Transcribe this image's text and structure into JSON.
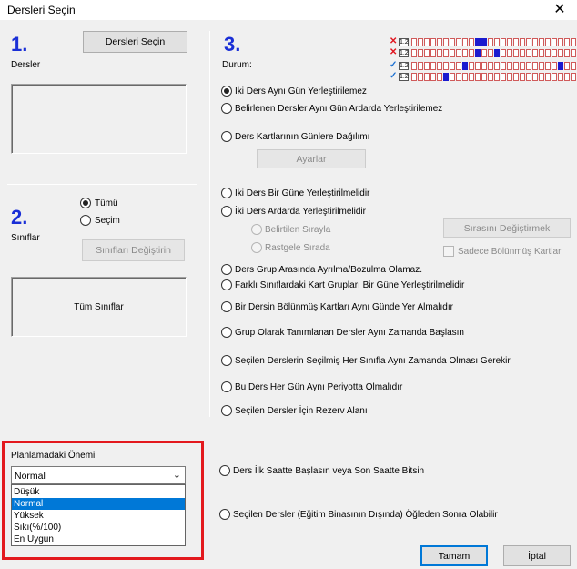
{
  "window": {
    "title": "Dersleri Seçin",
    "close_glyph": "✕"
  },
  "step1": {
    "number": "1.",
    "label": "Dersler",
    "select_button": "Dersleri Seçin"
  },
  "step2": {
    "number": "2.",
    "label": "Sınıflar",
    "radio_all": "Tümü",
    "radio_selection": "Seçim",
    "change_button": "Sınıfları Değiştirin",
    "classes_box": "Tüm Sınıflar"
  },
  "importance": {
    "label": "Planlamadaki Önemi",
    "selected": "Normal",
    "options": [
      "Düşük",
      "Normal",
      "Yüksek",
      "Sıkı(%/100)",
      "En Uygun"
    ]
  },
  "step3": {
    "number": "3.",
    "status_label": "Durum:",
    "status_rows": [
      {
        "mark": "✕",
        "code": "1.2"
      },
      {
        "mark": "✕",
        "code": "1.2"
      },
      {
        "mark": "✓",
        "code": "1.2"
      },
      {
        "mark": "✓",
        "code": "1.2"
      }
    ],
    "constraints": {
      "c1": "İki Ders Aynı Gün Yerleştirilemez",
      "c2": "Belirlenen Dersler Aynı Gün Ardarda Yerleştirilemez",
      "c3": "Ders Kartlarının Günlere Dağılımı",
      "settings_button": "Ayarlar",
      "c4": "İki Ders Bir Güne Yerleştirilmelidir",
      "c5": "İki Ders Ardarda Yerleştirilmelidir",
      "c5a": "Belirtilen Sırayla",
      "c5b": "Rastgele Sırada",
      "change_order_button": "Sırasını Değiştirmek",
      "only_split_cards": "Sadece Bölünmüş Kartlar",
      "c6": "Ders Grup Arasında Ayrılma/Bozulma Olamaz.",
      "c7": "Farklı Sınıflardaki Kart Grupları Bir Güne Yerleştirilmelidir",
      "c8": "Bir Dersin Bölünmüş Kartları Aynı Günde Yer Almalıdır",
      "c9": "Grup Olarak Tanımlanan Dersler Aynı Zamanda Başlasın",
      "c10": "Seçilen Derslerin Seçilmiş Her Sınıfla Aynı Zamanda Olması Gerekir",
      "c11": "Bu Ders Her Gün Aynı Periyotta Olmalıdır",
      "c12": "Seçilen Dersler İçin Rezerv Alanı",
      "c13": "Ders İlk Saatte Başlasın veya Son Saatte Bitsin",
      "c14": "Seçilen Dersler (Eğitim Binasının Dışında) Öğleden Sonra Olabilir"
    }
  },
  "footer": {
    "ok_button": "Tamam",
    "cancel_button": "İptal"
  },
  "colors": {
    "accent": "#0078d7",
    "step_number": "#1a2fd6",
    "highlight_border": "#e3191e"
  }
}
